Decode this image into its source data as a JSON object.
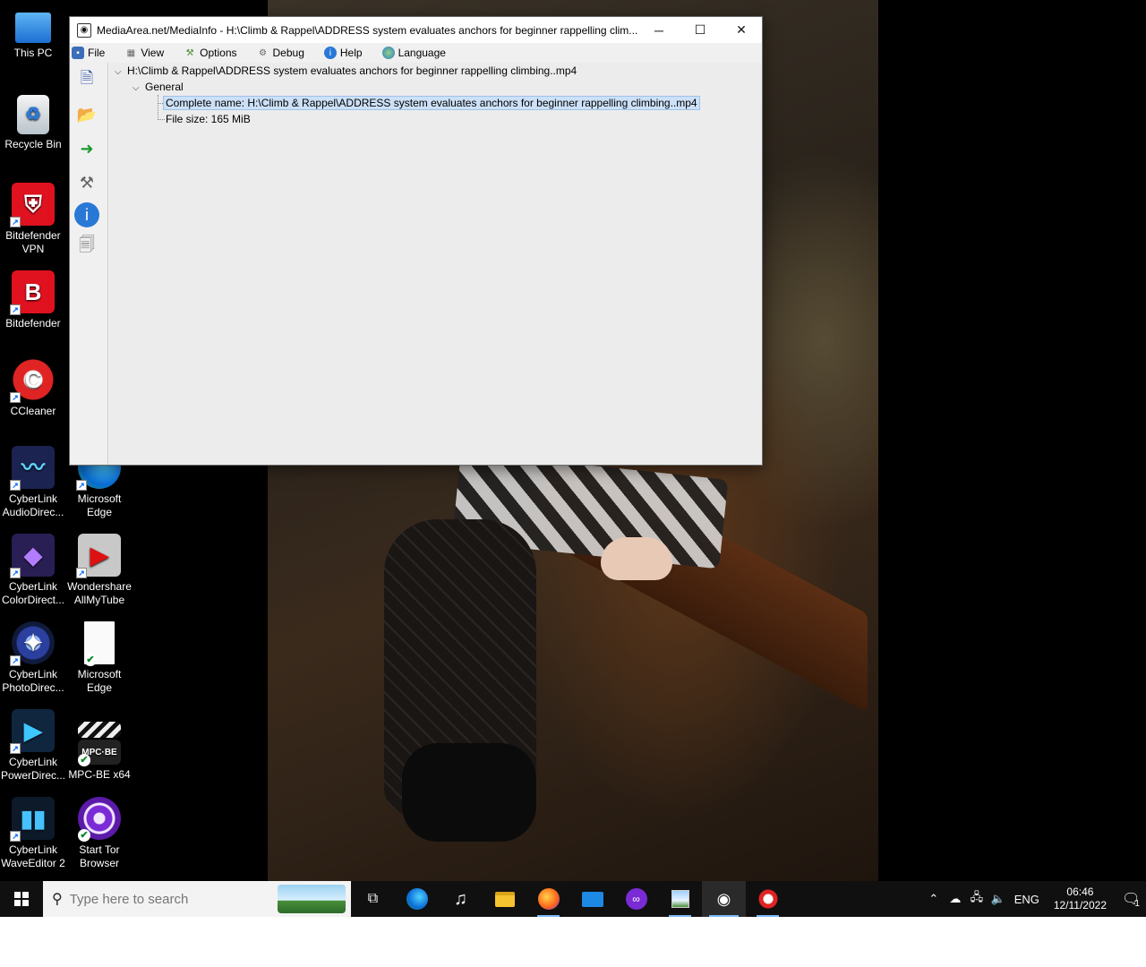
{
  "desktop": {
    "icons": [
      {
        "label": "This PC"
      },
      {
        "label": "Recycle Bin"
      },
      {
        "label": "Bitdefender VPN"
      },
      {
        "label": "Bitdefender"
      },
      {
        "label": "CCleaner"
      },
      {
        "label": "CyberLink AudioDirec..."
      },
      {
        "label": "Microsoft Edge"
      },
      {
        "label": "CyberLink ColorDirect..."
      },
      {
        "label": "Wondershare AllMyTube"
      },
      {
        "label": "CyberLink PhotoDirec..."
      },
      {
        "label": "Microsoft Edge"
      },
      {
        "label": "CyberLink PowerDirec..."
      },
      {
        "label": "MPC-BE x64"
      },
      {
        "label": "CyberLink WaveEditor 2"
      },
      {
        "label": "Start Tor Browser"
      }
    ]
  },
  "window": {
    "title": "MediaArea.net/MediaInfo - H:\\Climb & Rappel\\ADDRESS system evaluates anchors for beginner rappelling  clim...",
    "minimize": "─",
    "maximize": "☐",
    "close": "✕",
    "menu": [
      "File",
      "View",
      "Options",
      "Debug",
      "Help",
      "Language"
    ],
    "tree": {
      "root": "H:\\Climb & Rappel\\ADDRESS system evaluates anchors for beginner rappelling  climbing..mp4",
      "section": "General",
      "complete_name": "Complete name: H:\\Climb & Rappel\\ADDRESS system evaluates anchors for beginner rappelling  climbing..mp4",
      "file_size": "File size: 165 MiB"
    }
  },
  "taskbar": {
    "search_placeholder": "Type here to search",
    "language": "ENG",
    "time": "06:46",
    "date": "12/11/2022",
    "notification_count": "1"
  }
}
